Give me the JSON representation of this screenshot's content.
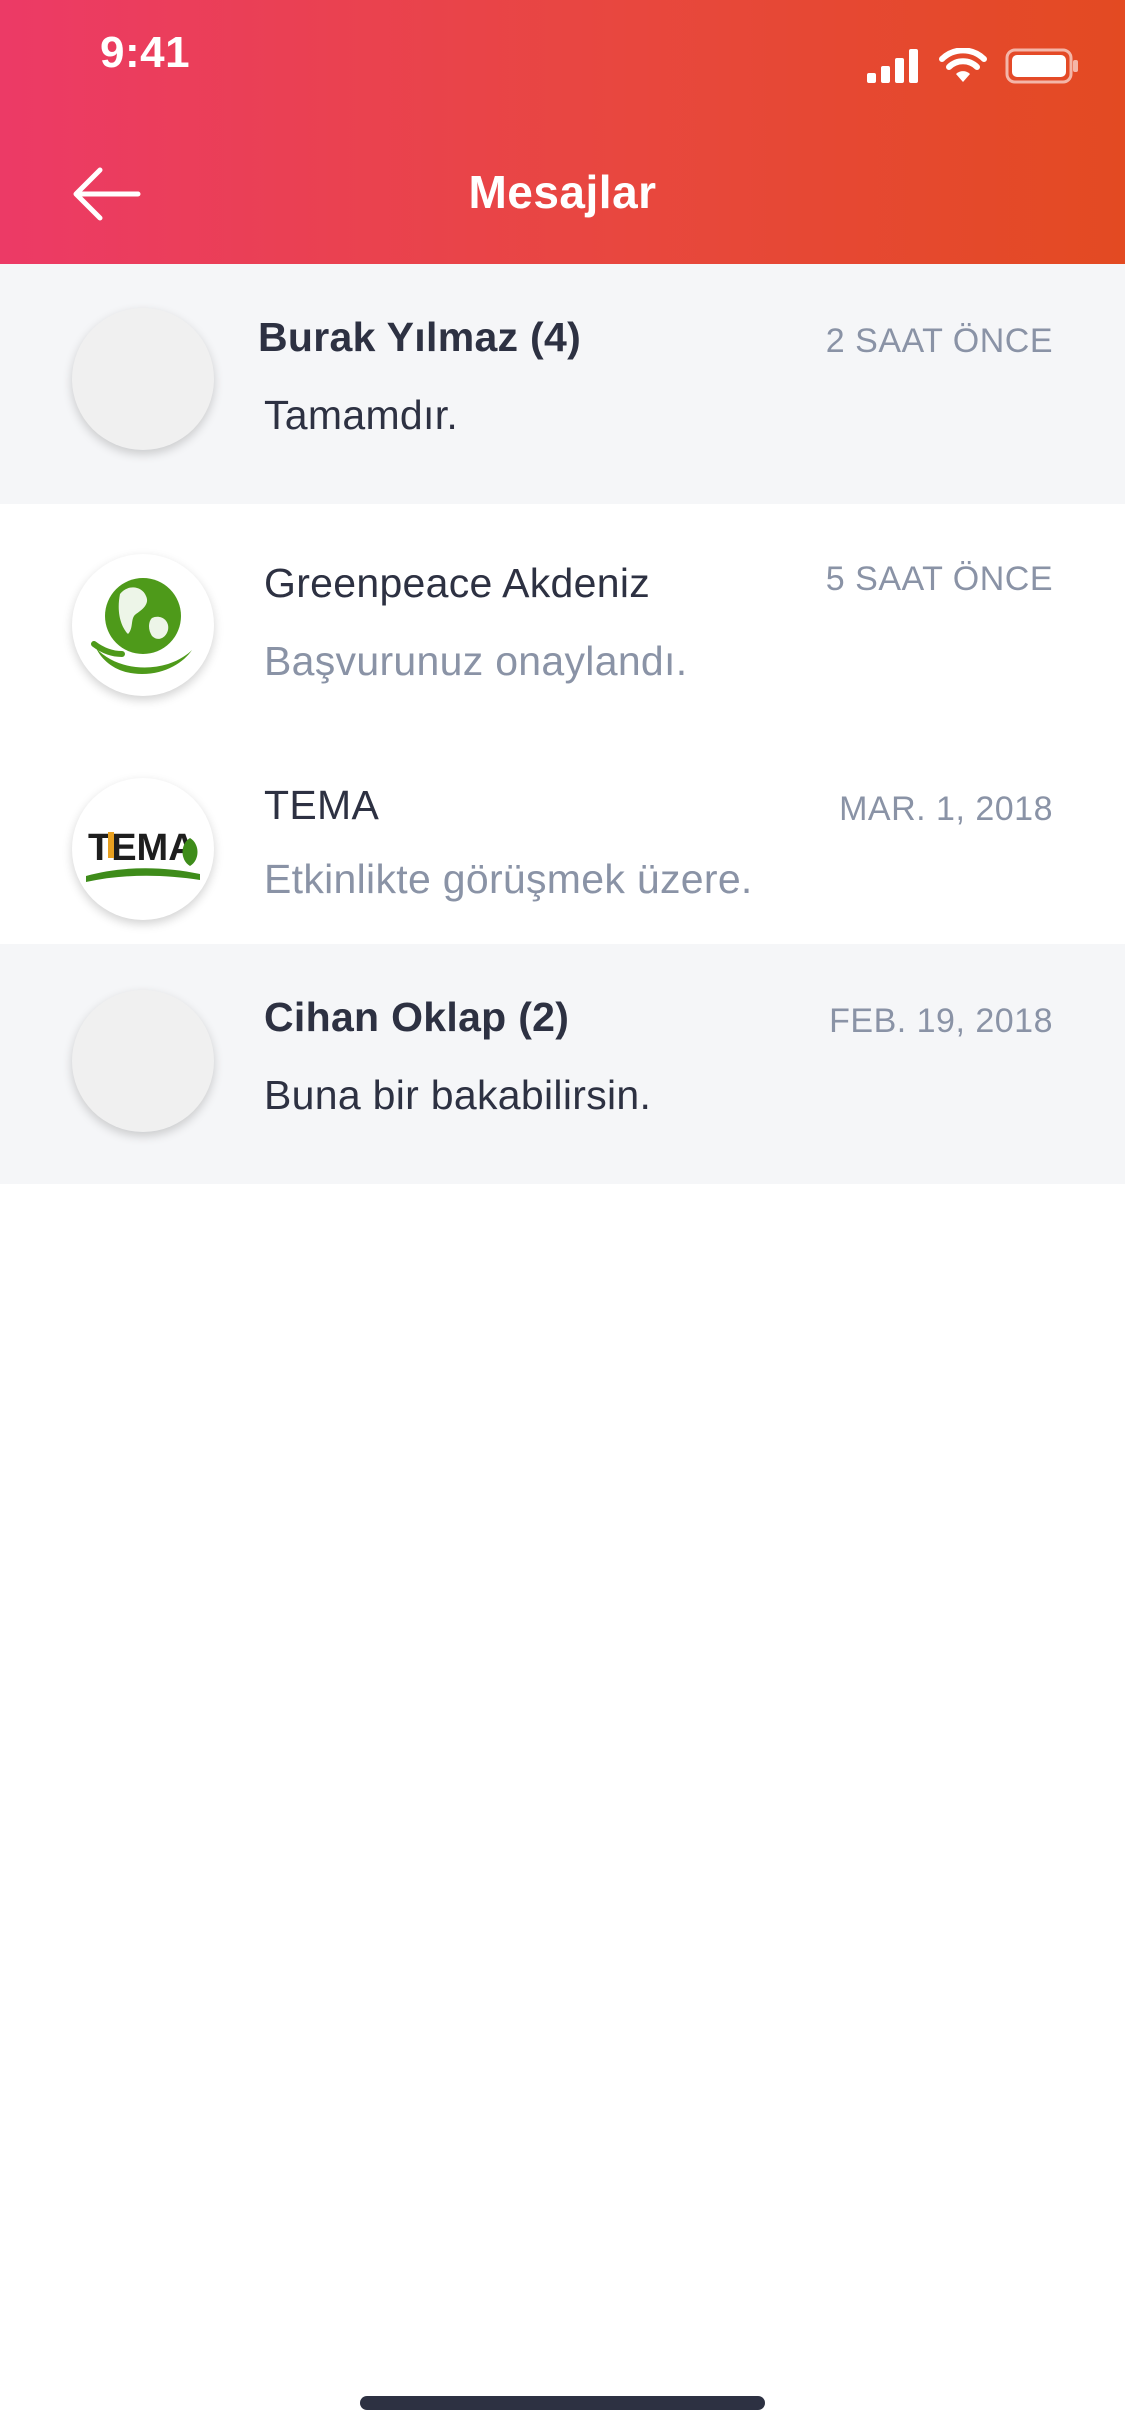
{
  "status_bar": {
    "time": "9:41",
    "icons": [
      "signal-icon",
      "wifi-icon",
      "battery-icon"
    ]
  },
  "header": {
    "title": "Mesajlar",
    "back_icon": "arrow-left-icon"
  },
  "colors": {
    "header_gradient_start": "#EC3A66",
    "header_gradient_end": "#E34A22",
    "unread_row_bg": "#F5F6F8",
    "primary_text": "#2D3142",
    "secondary_text": "#8A93A6"
  },
  "messages": [
    {
      "name": "Burak Yılmaz (4)",
      "time": "2 SAAT ÖNCE",
      "preview": "Tamamdır.",
      "unread": true,
      "avatar": "placeholder"
    },
    {
      "name": "Greenpeace Akdeniz",
      "time": "5 SAAT ÖNCE",
      "preview": "Başvurunuz onaylandı.",
      "unread": false,
      "avatar": "globe-logo"
    },
    {
      "name": "TEMA",
      "time": "MAR. 1, 2018",
      "preview": "Etkinlikte görüşmek üzere.",
      "unread": false,
      "avatar": "tema-logo",
      "logo_text": "TEMA"
    },
    {
      "name": "Cihan Oklap (2)",
      "time": "FEB. 19, 2018",
      "preview": "Buna bir bakabilirsin.",
      "unread": true,
      "avatar": "placeholder"
    }
  ]
}
